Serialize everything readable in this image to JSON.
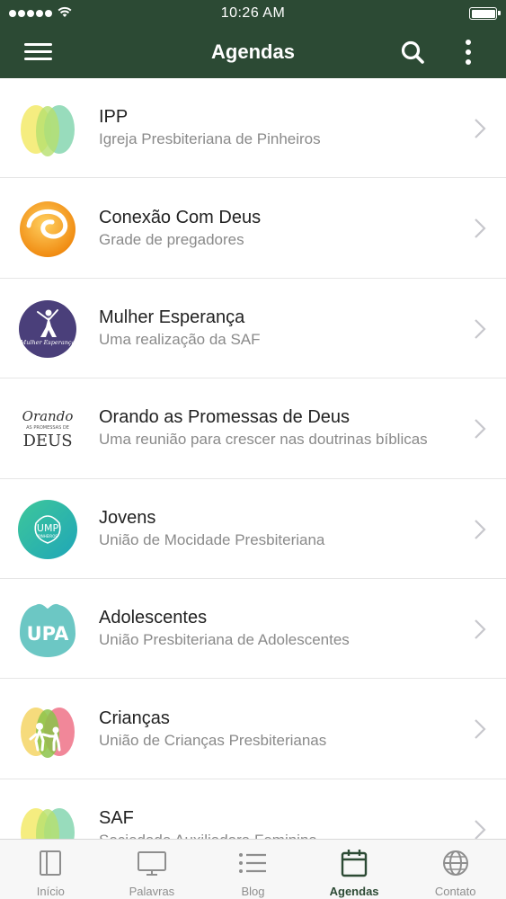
{
  "status_bar": {
    "time": "10:26 AM"
  },
  "header": {
    "title": "Agendas",
    "menu_icon": "hamburger-menu-icon",
    "search_icon": "search-icon",
    "more_icon": "more-vertical-icon"
  },
  "colors": {
    "header_background": "#2c4a34",
    "active_tab": "#2c4a34",
    "subtitle_text": "#8a8a8a"
  },
  "agendas": [
    {
      "name": "IPP",
      "subtitle": "Igreja Presbiteriana de Pinheiros",
      "icon": "ipp-lotus-logo"
    },
    {
      "name": "Conexão Com Deus",
      "subtitle": "Grade de pregadores",
      "icon": "conexao-swirl-logo"
    },
    {
      "name": "Mulher Esperança",
      "subtitle": "Uma realização da SAF",
      "icon": "mulher-esperanca-logo",
      "logo_text": "Mulher Esperança"
    },
    {
      "name": "Orando as Promessas de Deus",
      "subtitle": "Uma reunião para crescer nas doutrinas bíblicas",
      "icon": "orando-promessas-logo",
      "logo_text": [
        "Orando",
        "AS PROMESSAS DE",
        "DEUS"
      ]
    },
    {
      "name": "Jovens",
      "subtitle": "União de Mocidade Presbiteriana",
      "icon": "ump-logo",
      "logo_text": [
        "UMP",
        "PINHEIROS"
      ]
    },
    {
      "name": "Adolescentes",
      "subtitle": "União Presbiteriana de Adolescentes",
      "icon": "upa-logo",
      "logo_text": "UPA"
    },
    {
      "name": "Crianças",
      "subtitle": "União de Crianças Presbiterianas",
      "icon": "ucp-children-logo"
    },
    {
      "name": "SAF",
      "subtitle": "Sociedade Auxiliadora Feminina",
      "icon": "saf-lotus-logo"
    }
  ],
  "tabs": [
    {
      "label": "Início",
      "icon": "home-panel-icon",
      "active": false
    },
    {
      "label": "Palavras",
      "icon": "monitor-icon",
      "active": false
    },
    {
      "label": "Blog",
      "icon": "list-icon",
      "active": false
    },
    {
      "label": "Agendas",
      "icon": "calendar-icon",
      "active": true
    },
    {
      "label": "Contato",
      "icon": "globe-icon",
      "active": false
    }
  ]
}
